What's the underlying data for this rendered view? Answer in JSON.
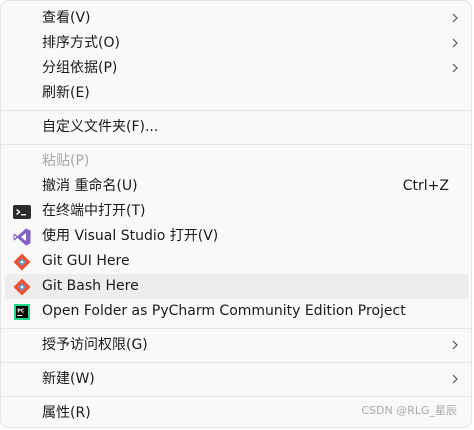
{
  "menu": {
    "items": [
      {
        "label": "查看(V)"
      },
      {
        "label": "排序方式(O)"
      },
      {
        "label": "分组依据(P)"
      },
      {
        "label": "刷新(E)"
      },
      {
        "label": "自定义文件夹(F)..."
      },
      {
        "label": "粘贴(P)"
      },
      {
        "label": "撤消 重命名(U)",
        "shortcut": "Ctrl+Z"
      },
      {
        "label": "在终端中打开(T)"
      },
      {
        "label": "使用 Visual Studio 打开(V)"
      },
      {
        "label": "Git GUI Here"
      },
      {
        "label": "Git Bash Here"
      },
      {
        "label": "Open Folder as PyCharm Community Edition Project"
      },
      {
        "label": "授予访问权限(G)"
      },
      {
        "label": "新建(W)"
      },
      {
        "label": "属性(R)"
      }
    ]
  },
  "icons": {
    "terminal": "terminal-icon",
    "visual_studio": "visual-studio-icon",
    "git_gui": "git-icon",
    "git_bash": "git-icon",
    "pycharm": "pycharm-icon",
    "submenu": "chevron-right-icon"
  },
  "colors": {
    "menu_background": "#f9f9f9",
    "hover_background": "#ededed",
    "disabled_text": "#a7a7a7",
    "git_orange": "#f05133",
    "vs_purple": "#8661c5"
  },
  "watermark": "CSDN @RLG_星辰"
}
